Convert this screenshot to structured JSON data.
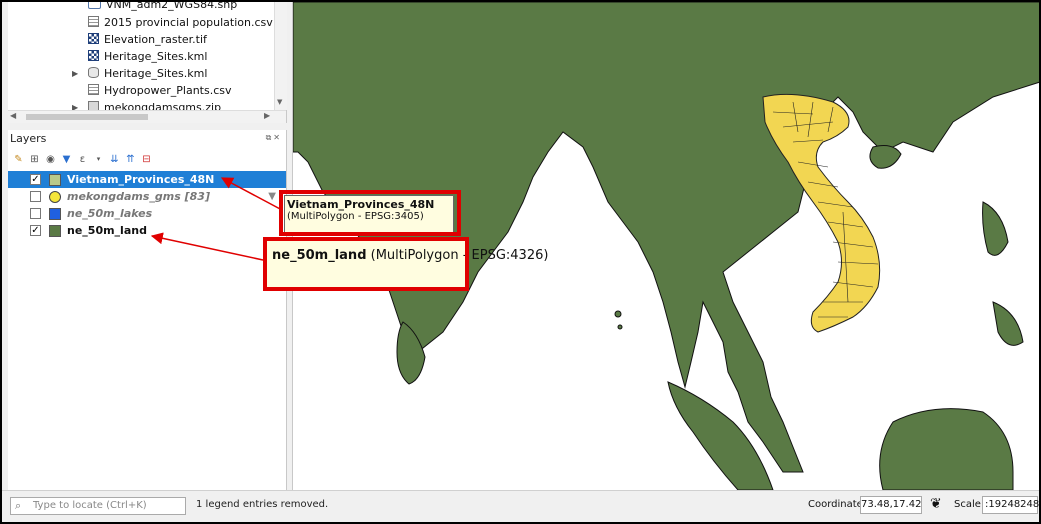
{
  "browser": {
    "items": [
      {
        "label": "VNM_adm2_WGS84.shp",
        "icon": "shapefile-icon"
      },
      {
        "label": "2015 provincial population.csv",
        "icon": "csv-icon"
      },
      {
        "label": "Elevation_raster.tif",
        "icon": "raster-icon"
      },
      {
        "label": "Heritage_Sites.kml",
        "icon": "raster-icon"
      },
      {
        "label": "Heritage_Sites.kml",
        "icon": "database-icon"
      },
      {
        "label": "Hydropower_Plants.csv",
        "icon": "csv-icon"
      },
      {
        "label": "mekongdamsgms.zip",
        "icon": "zip-icon"
      }
    ]
  },
  "layers": {
    "title": "Layers",
    "items": [
      {
        "name": "Vietnam_Provinces_48N",
        "checked": "✓",
        "color": "#e8d27a",
        "selected": true
      },
      {
        "name": "mekongdams_gms [83]",
        "checked": "",
        "color": "#f5e53a",
        "selected": false
      },
      {
        "name": "ne_50m_lakes",
        "checked": "",
        "color": "#2060e0",
        "selected": false
      },
      {
        "name": "ne_50m_land",
        "checked": "✓",
        "color": "#5a7a45",
        "selected": false
      }
    ]
  },
  "tooltips": {
    "t1": {
      "title": "Vietnam_Provinces_48N",
      "subtitle": "(MultiPolygon - EPSG:3405)"
    },
    "t2": {
      "title": "ne_50m_land",
      "subtitle": "(MultiPolygon - EPSG:4326)"
    }
  },
  "status": {
    "locate_placeholder": "Type to locate (Ctrl+K)",
    "message": "1 legend entries removed.",
    "coordinate_label": "Coordinate",
    "coordinate_value": "73.48,17.42",
    "scale_label": "Scale",
    "scale_value": ":19248248"
  },
  "colors": {
    "land": "#5a7a45",
    "vietnam": "#f2d652",
    "selection": "#1f7fd6",
    "highlight": "#e00000"
  }
}
